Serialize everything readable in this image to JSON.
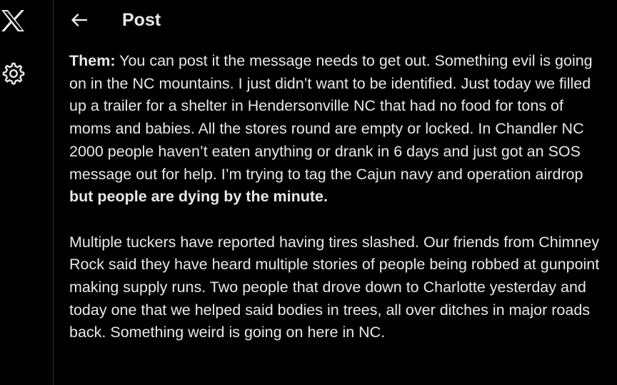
{
  "header": {
    "title": "Post"
  },
  "icons": {
    "logo": "x-logo-icon",
    "settings": "gear-icon",
    "back": "back-arrow-icon"
  },
  "post": {
    "p1_speaker": "Them:",
    "p1_text": " You can post it the message needs to get out. Something evil is going on in the NC mountains. I just didn’t want to be identified. Just today we filled up a trailer for a shelter in Hendersonville NC that had no food for tons of moms and babies. All the stores round are empty or locked. In Chandler NC 2000 people haven’t eaten anything or drank in 6 days and just got an SOS message out for help. I’m trying to tag the Cajun navy and operation airdrop ",
    "p1_bold_end": "but people are dying by the minute.",
    "p2_text": "Multiple tuckers have reported having tires slashed. Our friends from Chimney Rock said they have heard multiple stories of people being robbed at gunpoint making supply runs. Two people that drove down to Charlotte yesterday and today one that we helped said bodies in trees, all over ditches in major roads back. Something weird is going on here in NC."
  },
  "colors": {
    "background": "#000000",
    "text": "#e7e9ea",
    "divider": "#2f3336"
  }
}
